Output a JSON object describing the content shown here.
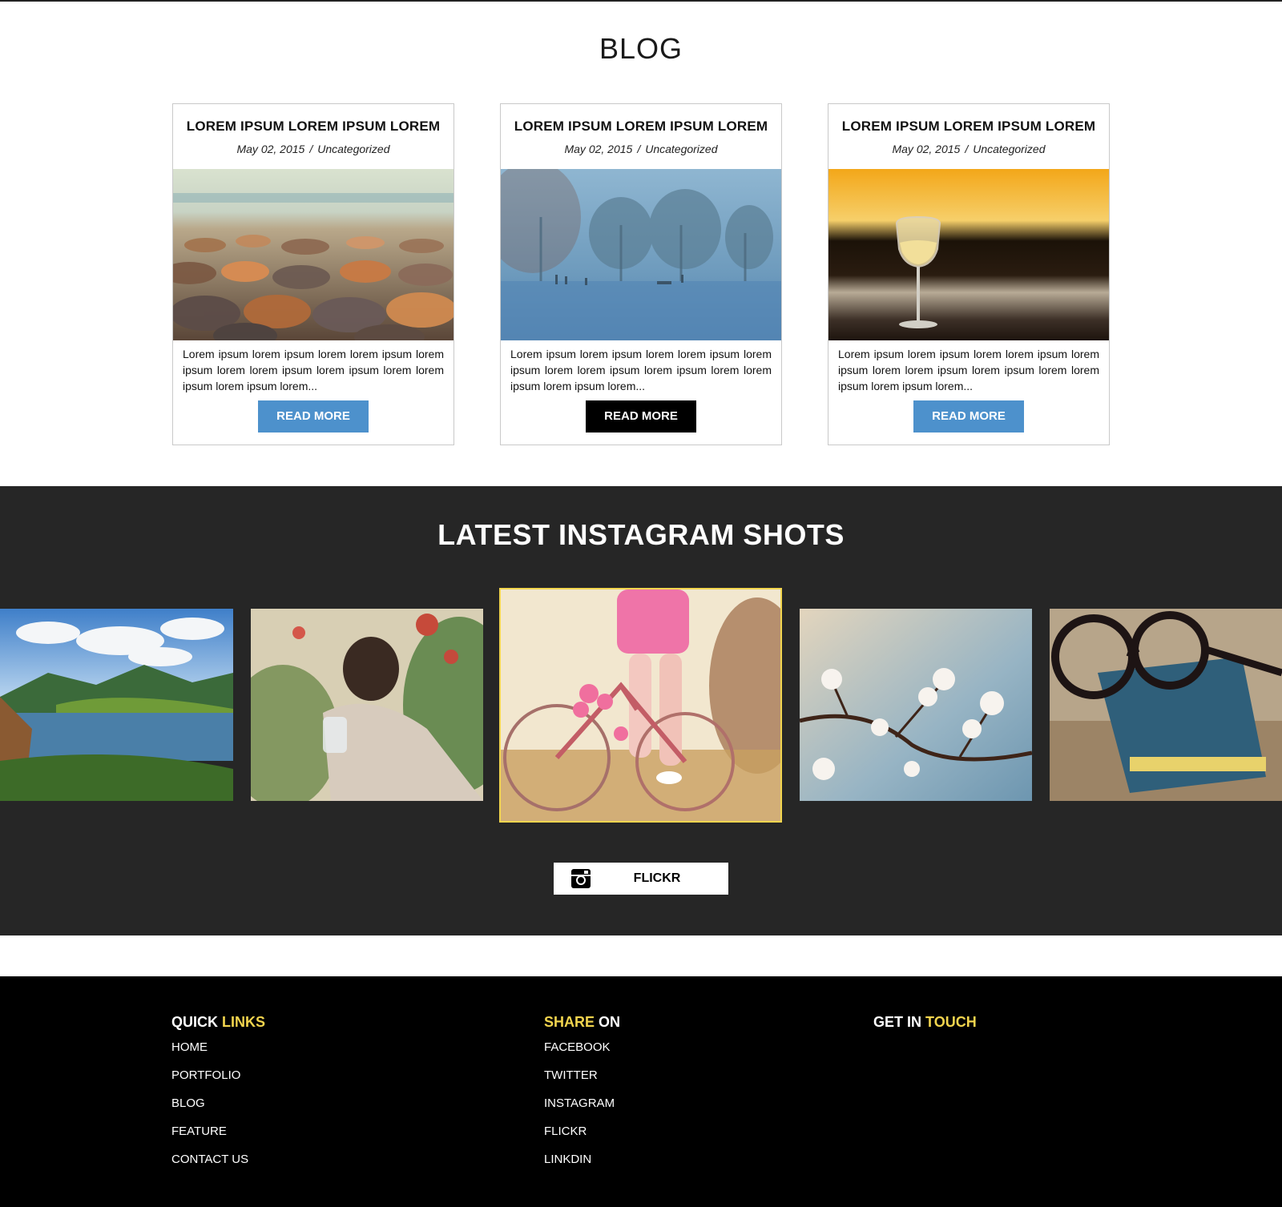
{
  "blog": {
    "title": "BLOG",
    "posts": [
      {
        "title": "LOREM IPSUM LOREM IPSUM LOREM",
        "date": "May 02, 2015",
        "separator": "/",
        "category": "Uncategorized",
        "excerpt": "Lorem ipsum lorem ipsum lorem lorem ipsum lorem ipsum lorem lorem ipsum lorem ipsum lorem lorem ipsum lorem ipsum lorem...",
        "button": "READ MORE"
      },
      {
        "title": "LOREM IPSUM LOREM IPSUM LOREM",
        "date": "May 02, 2015",
        "separator": "/",
        "category": "Uncategorized",
        "excerpt": "Lorem ipsum lorem ipsum lorem lorem ipsum lorem ipsum lorem lorem ipsum lorem ipsum lorem lorem ipsum lorem ipsum lorem...",
        "button": "READ MORE"
      },
      {
        "title": "LOREM IPSUM LOREM IPSUM LOREM",
        "date": "May 02, 2015",
        "separator": "/",
        "category": "Uncategorized",
        "excerpt": "Lorem ipsum lorem ipsum lorem lorem ipsum lorem ipsum lorem lorem ipsum lorem ipsum lorem lorem ipsum lorem ipsum lorem...",
        "button": "READ MORE"
      }
    ]
  },
  "instagram": {
    "title": "LATEST INSTAGRAM SHOTS",
    "flickr_button": "FLICKR",
    "flickr_icon": "instagram-icon",
    "active_border_color": "#f2d54e"
  },
  "footer": {
    "quick_links": {
      "heading_a": "QUICK",
      "heading_b": "LINKS",
      "items": [
        "HOME",
        "PORTFOLIO",
        "BLOG",
        "FEATURE",
        "CONTACT US"
      ]
    },
    "share_on": {
      "heading_a": "SHARE",
      "heading_b": "ON",
      "items": [
        "FACEBOOK",
        "TWITTER",
        "INSTAGRAM",
        "FLICKR",
        "LINKDIN"
      ]
    },
    "get_in_touch": {
      "heading_a": "GET IN",
      "heading_b": "TOUCH"
    }
  },
  "colors": {
    "accent_yellow": "#f2d54e",
    "button_blue": "#4d91cc",
    "dark_section": "#262626",
    "footer_bg": "#000000"
  }
}
